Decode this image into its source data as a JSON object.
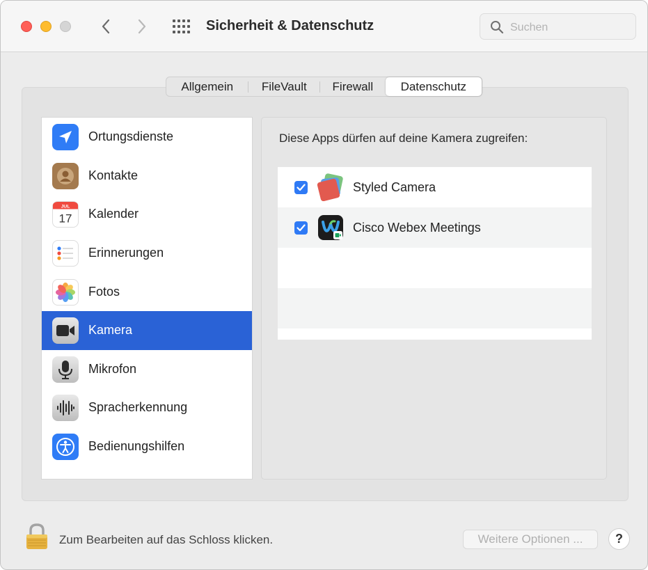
{
  "window": {
    "title": "Sicherheit & Datenschutz"
  },
  "search": {
    "placeholder": "Suchen"
  },
  "tabs": [
    {
      "label": "Allgemein",
      "selected": false
    },
    {
      "label": "FileVault",
      "selected": false
    },
    {
      "label": "Firewall",
      "selected": false
    },
    {
      "label": "Datenschutz",
      "selected": true
    }
  ],
  "sidebar": {
    "items": [
      {
        "label": "Ortungsdienste",
        "icon": "location-arrow-icon",
        "selected": false
      },
      {
        "label": "Kontakte",
        "icon": "contacts-icon",
        "selected": false
      },
      {
        "label": "Kalender",
        "icon": "calendar-icon",
        "selected": false,
        "month": "JUL",
        "day": "17"
      },
      {
        "label": "Erinnerungen",
        "icon": "reminders-icon",
        "selected": false
      },
      {
        "label": "Fotos",
        "icon": "photos-icon",
        "selected": false
      },
      {
        "label": "Kamera",
        "icon": "camera-icon",
        "selected": true
      },
      {
        "label": "Mikrofon",
        "icon": "microphone-icon",
        "selected": false
      },
      {
        "label": "Spracherkennung",
        "icon": "speech-recognition-icon",
        "selected": false
      },
      {
        "label": "Bedienungshilfen",
        "icon": "accessibility-icon",
        "selected": false
      }
    ]
  },
  "main": {
    "heading": "Diese Apps dürfen auf deine Kamera zugreifen:",
    "apps": [
      {
        "name": "Styled Camera",
        "checked": true,
        "icon": "styled-camera-app-icon"
      },
      {
        "name": "Cisco Webex Meetings",
        "checked": true,
        "icon": "webex-app-icon"
      }
    ]
  },
  "footer": {
    "lock_text": "Zum Bearbeiten auf das Schloss klicken.",
    "more_options_label": "Weitere Optionen ...",
    "help_label": "?"
  },
  "colors": {
    "accent": "#2a62d6",
    "checkbox": "#2f7af5",
    "traffic_close": "#ff5f57",
    "traffic_minimize": "#febc2e",
    "traffic_zoom": "#d5d5d5"
  }
}
